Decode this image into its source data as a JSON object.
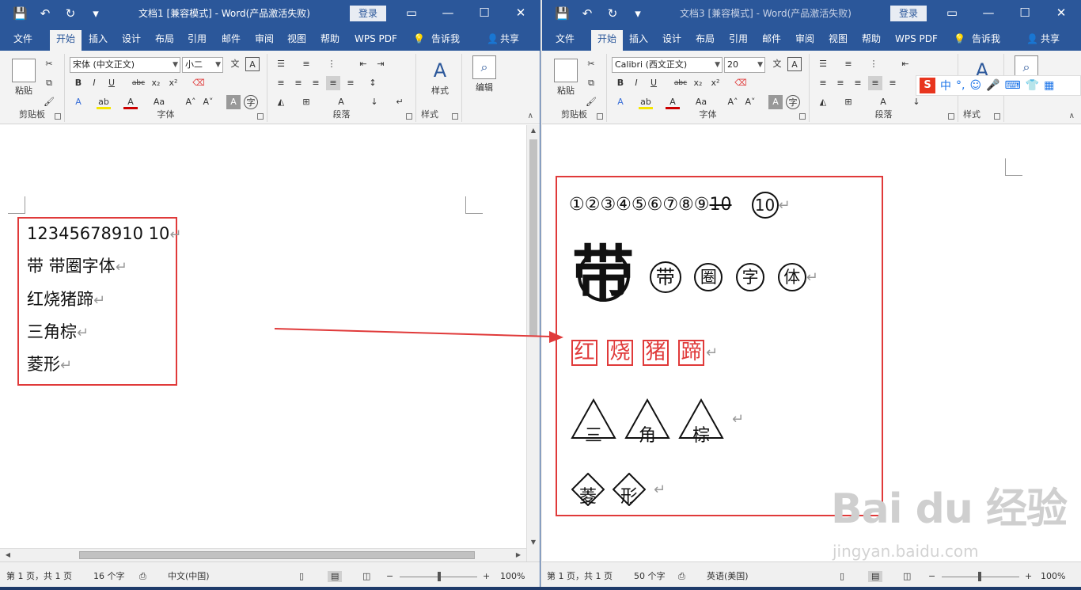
{
  "left": {
    "qat": {
      "save": "💾",
      "undo": "↶",
      "redo": "↻",
      "more": "▾"
    },
    "title": "文档1 [兼容模式] - Word(产品激活失败)",
    "login": "登录",
    "tabs": [
      "文件",
      "开始",
      "插入",
      "设计",
      "布局",
      "引用",
      "邮件",
      "审阅",
      "视图",
      "帮助",
      "WPS PDF",
      "告诉我",
      "共享"
    ],
    "ribbon": {
      "paste": "粘贴",
      "clipboard": "剪贴板",
      "font_name": "宋体 (中文正文)",
      "font_size": "小二",
      "font_group": "字体",
      "para_group": "段落",
      "styles": "样式",
      "styles_group": "样式",
      "edit": "编辑"
    },
    "doc_lines": [
      "12345678910 10",
      "带  带圈字体",
      "红烧猪蹄",
      "三角棕",
      "菱形"
    ],
    "status": {
      "page": "第 1 页，共 1 页",
      "words": "16 个字",
      "lang": "中文(中国)",
      "zoom": "100%"
    }
  },
  "right": {
    "qat": {
      "save": "💾",
      "undo": "↶",
      "redo": "↻",
      "more": "▾"
    },
    "title": "文档3 [兼容模式] - Word(产品激活失败)",
    "login": "登录",
    "tabs": [
      "文件",
      "开始",
      "插入",
      "设计",
      "布局",
      "引用",
      "邮件",
      "审阅",
      "视图",
      "帮助",
      "WPS PDF",
      "告诉我",
      "共享"
    ],
    "ribbon": {
      "paste": "粘贴",
      "clipboard": "剪贴板",
      "font_name": "Calibri (西文正文)",
      "font_size": "20",
      "font_group": "字体",
      "para_group": "段落",
      "styles": "样式",
      "styles_group": "样式"
    },
    "doc": {
      "circled_nums": "①②③④⑤⑥⑦⑧⑨",
      "struck_ten": "10",
      "circled_ten": "10",
      "big_char": "带",
      "circle_chars": [
        "带",
        "圈",
        "字",
        "体"
      ],
      "red_chars": [
        "红",
        "烧",
        "猪",
        "蹄"
      ],
      "tri_chars": [
        "三",
        "角",
        "棕"
      ],
      "dia_chars": [
        "菱",
        "形"
      ]
    },
    "status": {
      "page": "第 1 页，共 1 页",
      "words": "50 个字",
      "lang": "英语(美国)",
      "zoom": "100%"
    }
  },
  "ime": {
    "logo": "S",
    "mode": "中",
    "punct": "°,",
    "emoji": "☺",
    "mic": "🎤",
    "kb": "⌨",
    "skin": "👕",
    "grid": "▦"
  },
  "watermark": {
    "main": "Bai du 经验",
    "sub": "jingyan.baidu.com"
  },
  "colors": {
    "word_blue": "#2b579a",
    "annotation_red": "#e03a3a"
  }
}
